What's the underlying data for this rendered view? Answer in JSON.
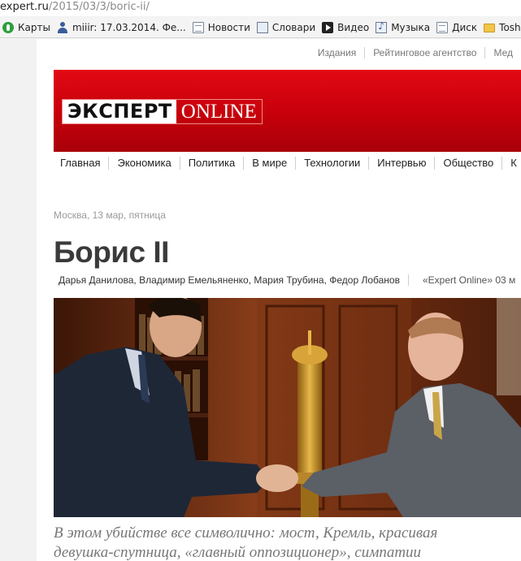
{
  "browser": {
    "url_host": "expert.ru",
    "url_path": "/2015/03/3/boric-ii/"
  },
  "bookmarks": [
    {
      "label": "Карты",
      "icon": "maps-icon"
    },
    {
      "label": "miiir: 17.03.2014. Фе...",
      "icon": "user-icon"
    },
    {
      "label": "Новости",
      "icon": "page-icon"
    },
    {
      "label": "Словари",
      "icon": "dictionary-icon"
    },
    {
      "label": "Видео",
      "icon": "video-icon"
    },
    {
      "label": "Музыка",
      "icon": "music-icon"
    },
    {
      "label": "Диск",
      "icon": "page-icon"
    },
    {
      "label": "Toshib",
      "icon": "folder-icon"
    }
  ],
  "site": {
    "top_links": [
      "Издания",
      "Рейтинговое агентство",
      "Мед"
    ],
    "logo_main": "ЭКСПЕРТ",
    "logo_sub": "ONLINE",
    "nav": [
      "Главная",
      "Экономика",
      "Политика",
      "В мире",
      "Технологии",
      "Интервью",
      "Общество",
      "К"
    ],
    "accent_color": "#d4000d"
  },
  "article": {
    "dateline": "Москва, 13 мар, пятница",
    "title": "Борис II",
    "authors": "Дарья Данилова, Владимир Емельяненко, Мария Трубина, Федор Лобанов",
    "source": "«Expert Online» 03 м",
    "lead_line1": "В этом убийстве все символично: мост, Кремль, красивая",
    "lead_line2": "девушка-спутница, «главный оппозиционер», симпатии"
  }
}
